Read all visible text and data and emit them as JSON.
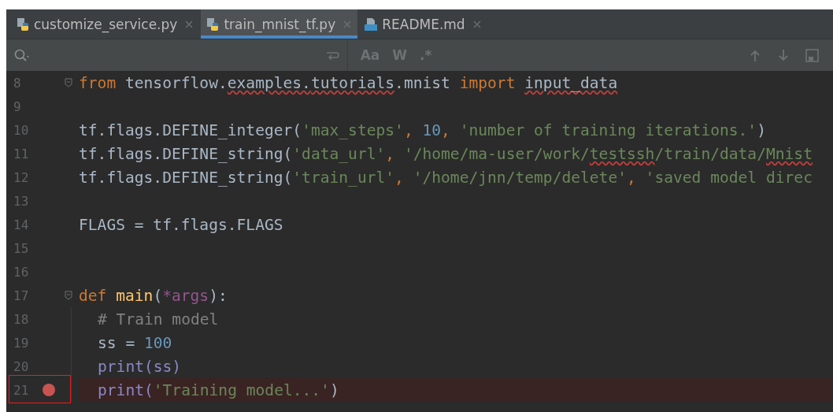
{
  "tabs": [
    {
      "label": "customize_service.py",
      "kind": "python",
      "selected": false
    },
    {
      "label": "train_mnist_tf.py",
      "kind": "python",
      "selected": true
    },
    {
      "label": "README.md",
      "kind": "markdown",
      "selected": false
    }
  ],
  "search_bar": {
    "options": [
      "Aa",
      "W",
      ".*"
    ]
  },
  "lines": [
    {
      "number": "8",
      "fold": true,
      "tokens": [
        {
          "t": "from ",
          "kind": "keyword"
        },
        {
          "t": "tensorflow.",
          "kind": "plain"
        },
        {
          "t": "examples.",
          "kind": "plain",
          "typo": true
        },
        {
          "t": "tutorials",
          "kind": "plain",
          "typo": true
        },
        {
          "t": ".mnist ",
          "kind": "plain"
        },
        {
          "t": "import ",
          "kind": "keyword"
        },
        {
          "t": "input_data",
          "kind": "plain",
          "typo": true
        }
      ]
    },
    {
      "number": "9"
    },
    {
      "number": "10",
      "tokens": [
        {
          "t": "tf.flags.DEFINE_integer(",
          "kind": "plain"
        },
        {
          "t": "'max_steps'",
          "kind": "string"
        },
        {
          "t": ", ",
          "kind": "keyword"
        },
        {
          "t": "10",
          "kind": "number"
        },
        {
          "t": ", ",
          "kind": "keyword"
        },
        {
          "t": "'number of training iterations.'",
          "kind": "string"
        },
        {
          "t": ")",
          "kind": "plain"
        }
      ]
    },
    {
      "number": "11",
      "tokens": [
        {
          "t": "tf.flags.DEFINE_string(",
          "kind": "plain"
        },
        {
          "t": "'data_url'",
          "kind": "string"
        },
        {
          "t": ", ",
          "kind": "keyword"
        },
        {
          "t": "'/home/ma-user/work/",
          "kind": "string"
        },
        {
          "t": "testssh",
          "kind": "string",
          "typo": true
        },
        {
          "t": "/train/data/",
          "kind": "string"
        },
        {
          "t": "Mnist",
          "kind": "string",
          "typo": true
        }
      ]
    },
    {
      "number": "12",
      "tokens": [
        {
          "t": "tf.flags.DEFINE_string(",
          "kind": "plain"
        },
        {
          "t": "'train_url'",
          "kind": "string"
        },
        {
          "t": ", ",
          "kind": "keyword"
        },
        {
          "t": "'/home/jnn/temp/delete'",
          "kind": "string"
        },
        {
          "t": ", ",
          "kind": "keyword"
        },
        {
          "t": "'saved model direc",
          "kind": "string"
        }
      ]
    },
    {
      "number": "13"
    },
    {
      "number": "14",
      "tokens": [
        {
          "t": "FLAGS = tf.flags.FLAGS",
          "kind": "plain"
        }
      ]
    },
    {
      "number": "15"
    },
    {
      "number": "16"
    },
    {
      "number": "17",
      "fold": true,
      "tokens": [
        {
          "t": "def ",
          "kind": "keyword"
        },
        {
          "t": "main",
          "kind": "func"
        },
        {
          "t": "(",
          "kind": "plain"
        },
        {
          "t": "*args",
          "kind": "param"
        },
        {
          "t": "):",
          "kind": "plain"
        }
      ],
      "children": [
        {
          "number": "18",
          "tokens": [
            {
              "t": "# Train model",
              "kind": "comment"
            }
          ]
        },
        {
          "number": "19",
          "tokens": [
            {
              "t": "ss = ",
              "kind": "plain"
            },
            {
              "t": "100",
              "kind": "number"
            }
          ]
        },
        {
          "number": "20",
          "tokens": [
            {
              "t": "print(ss)",
              "kind": "builtin"
            }
          ]
        },
        {
          "number": "21",
          "breakpoint": true,
          "annotated": true,
          "tokens": [
            {
              "t": "print(",
              "kind": "builtin"
            },
            {
              "t": "'Training model...'",
              "kind": "string"
            },
            {
              "t": ")",
              "kind": "plain"
            }
          ]
        }
      ]
    }
  ]
}
